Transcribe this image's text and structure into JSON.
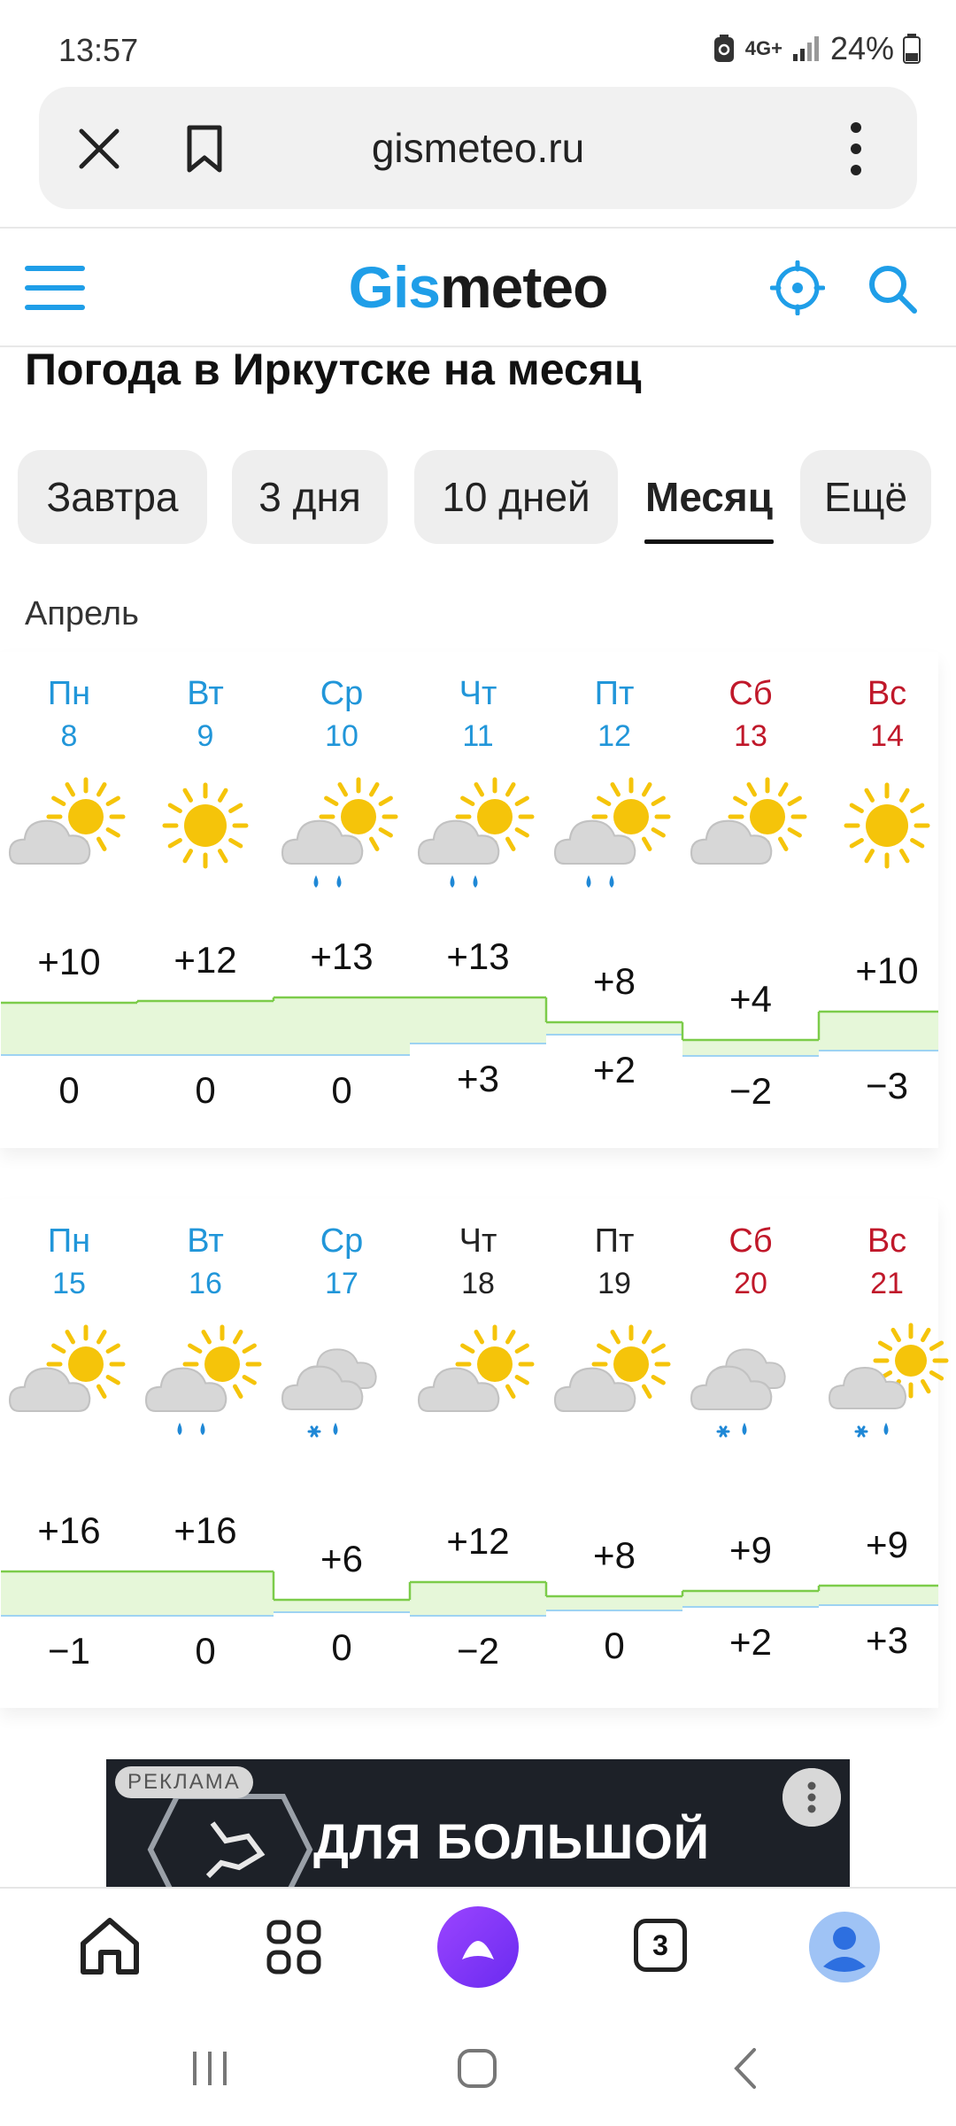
{
  "status": {
    "time": "13:57",
    "network": "4G+",
    "battery": "24%"
  },
  "browser": {
    "url": "gismeteo.ru",
    "tab_count": "3"
  },
  "site": {
    "logo_part1": "Gis",
    "logo_part2": "meteo"
  },
  "page_title": "Погода в Иркутске на месяц",
  "tabs": [
    "Завтра",
    "3 дня",
    "10 дней",
    "Месяц",
    "Ещё"
  ],
  "active_tab": "Месяц",
  "month_label": "Апрель",
  "weeks": [
    {
      "days": [
        {
          "name": "Пн",
          "num": "8",
          "weekend": false,
          "icon": "partly-cloudy-icon",
          "max": "+10",
          "min": "0"
        },
        {
          "name": "Вт",
          "num": "9",
          "weekend": false,
          "icon": "sun-icon",
          "max": "+12",
          "min": "0"
        },
        {
          "name": "Ср",
          "num": "10",
          "weekend": false,
          "icon": "partly-cloudy-rain-icon",
          "max": "+13",
          "min": "0"
        },
        {
          "name": "Чт",
          "num": "11",
          "weekend": false,
          "icon": "partly-cloudy-rain-icon",
          "max": "+13",
          "min": "+3"
        },
        {
          "name": "Пт",
          "num": "12",
          "weekend": false,
          "icon": "partly-cloudy-rain-icon",
          "max": "+8",
          "min": "+2"
        },
        {
          "name": "Сб",
          "num": "13",
          "weekend": true,
          "icon": "partly-cloudy-icon",
          "max": "+4",
          "min": "−2"
        },
        {
          "name": "Вс",
          "num": "14",
          "weekend": true,
          "icon": "sun-icon",
          "max": "+10",
          "min": "−3"
        }
      ]
    },
    {
      "days": [
        {
          "name": "Пн",
          "num": "15",
          "weekend": false,
          "icon": "partly-cloudy-icon",
          "max": "+16",
          "min": "−1"
        },
        {
          "name": "Вт",
          "num": "16",
          "weekend": false,
          "icon": "partly-cloudy-rain-icon",
          "max": "+16",
          "min": "0"
        },
        {
          "name": "Ср",
          "num": "17",
          "weekend": false,
          "icon": "cloudy-snow-rain-icon",
          "max": "+6",
          "min": "0"
        },
        {
          "name": "Чт",
          "num": "18",
          "weekend": false,
          "past": true,
          "icon": "partly-cloudy-icon",
          "max": "+12",
          "min": "−2"
        },
        {
          "name": "Пт",
          "num": "19",
          "weekend": false,
          "past": true,
          "icon": "partly-cloudy-icon",
          "max": "+8",
          "min": "0"
        },
        {
          "name": "Сб",
          "num": "20",
          "weekend": true,
          "icon": "cloudy-snow-rain-icon",
          "max": "+9",
          "min": "+2"
        },
        {
          "name": "Вс",
          "num": "21",
          "weekend": true,
          "icon": "partly-cloudy-snow-rain-icon",
          "max": "+9",
          "min": "+3"
        }
      ]
    }
  ],
  "colors": {
    "accent": "#1f9ee8",
    "weekday": "#2196d9",
    "weekend": "#c0182a",
    "past": "#222222",
    "temp_fill": "#e6f7d9",
    "temp_line": "#7ccc4a",
    "cold_line": "#9ed3f2"
  },
  "ad": {
    "badge": "РЕКЛАМА",
    "text": "ДЛЯ БОЛЬШОЙ"
  }
}
